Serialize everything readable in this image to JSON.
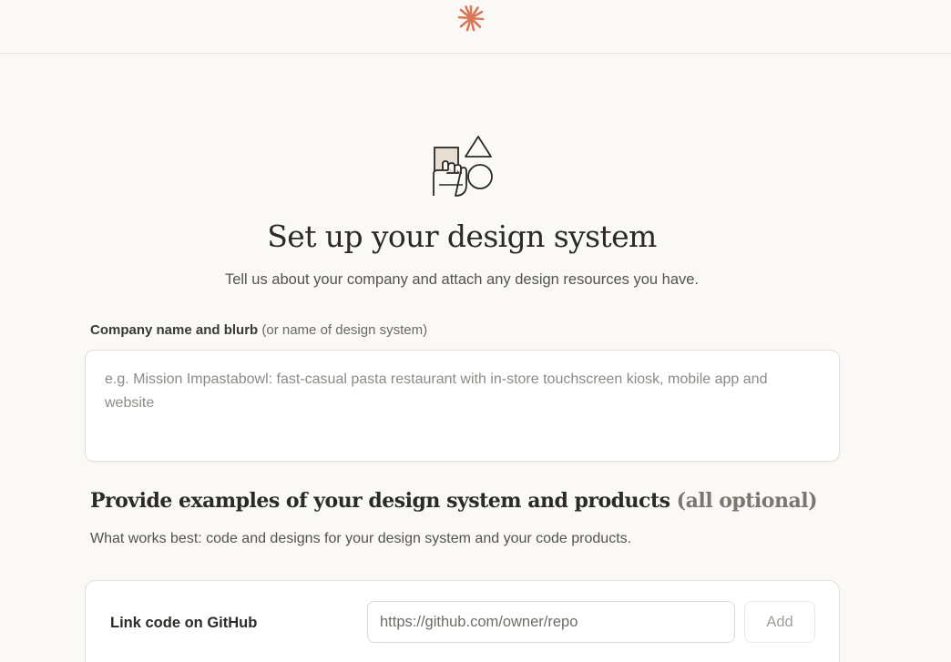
{
  "header": {
    "logo_icon": "asterisk-burst-icon",
    "logo_color": "#d97757"
  },
  "hero": {
    "illustration_icon": "hand-holding-shapes-icon",
    "title": "Set up your design system",
    "subtitle": "Tell us about your company and attach any design resources you have."
  },
  "company_field": {
    "label_strong": "Company name and blurb",
    "label_note": "(or name of design system)",
    "placeholder": "e.g. Mission Impastabowl: fast-casual pasta restaurant with in-store touchscreen kiosk, mobile app and website",
    "value": ""
  },
  "examples_section": {
    "title": "Provide examples of your design system and products",
    "title_note": "(all optional)",
    "subtitle": "What works best: code and designs for your design system and your code products."
  },
  "github_card": {
    "label": "Link code on GitHub",
    "placeholder": "https://github.com/owner/repo",
    "value": "",
    "add_label": "Add"
  },
  "colors": {
    "background": "#faf9f6",
    "accent": "#d97757",
    "text": "#2b2a27"
  }
}
